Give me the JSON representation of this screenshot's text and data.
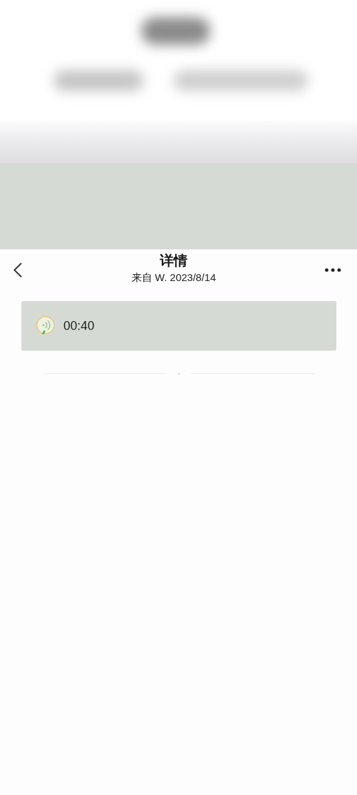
{
  "nav": {
    "title": "详情",
    "subtitle": "来自 W. 2023/8/14"
  },
  "voice_message": {
    "duration": "00:40"
  }
}
